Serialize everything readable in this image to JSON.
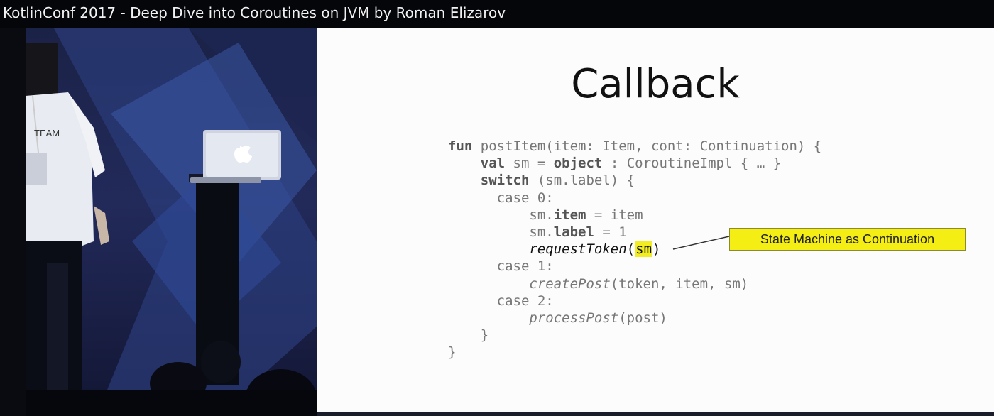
{
  "video": {
    "title": "KotlinConf 2017 - Deep Dive into Coroutines on JVM by Roman Elizarov"
  },
  "slide": {
    "title": "Callback",
    "callout": "State Machine as Continuation",
    "code": {
      "l1_fun": "fun",
      "l1_rest": " postItem(item: Item, cont: Continuation) {",
      "l2_val": "val",
      "l2_mid": " sm = ",
      "l2_obj": "object",
      "l2_rest": " : CoroutineImpl { … }",
      "l3_switch": "switch",
      "l3_rest": " (sm.label) {",
      "l4": "case 0:",
      "l5_a": "sm.",
      "l5_item": "item",
      "l5_rest": " = item",
      "l6_a": "sm.",
      "l6_label": "label",
      "l6_rest": " = 1",
      "l7_fn": "requestToken",
      "l7_open": "(",
      "l7_sm": "sm",
      "l7_close": ")",
      "l8": "case 1:",
      "l9_fn": "createPost",
      "l9_rest": "(token, item, sm)",
      "l10": "case 2:",
      "l11_fn": "processPost",
      "l11_rest": "(post)",
      "l12": "}",
      "l13": "}"
    }
  },
  "colors": {
    "callout_bg": "#f4ee15",
    "highlight": "#f2ec22",
    "stage_blue": "#222a5a"
  },
  "scene": {
    "badge_text": "TEAM"
  }
}
